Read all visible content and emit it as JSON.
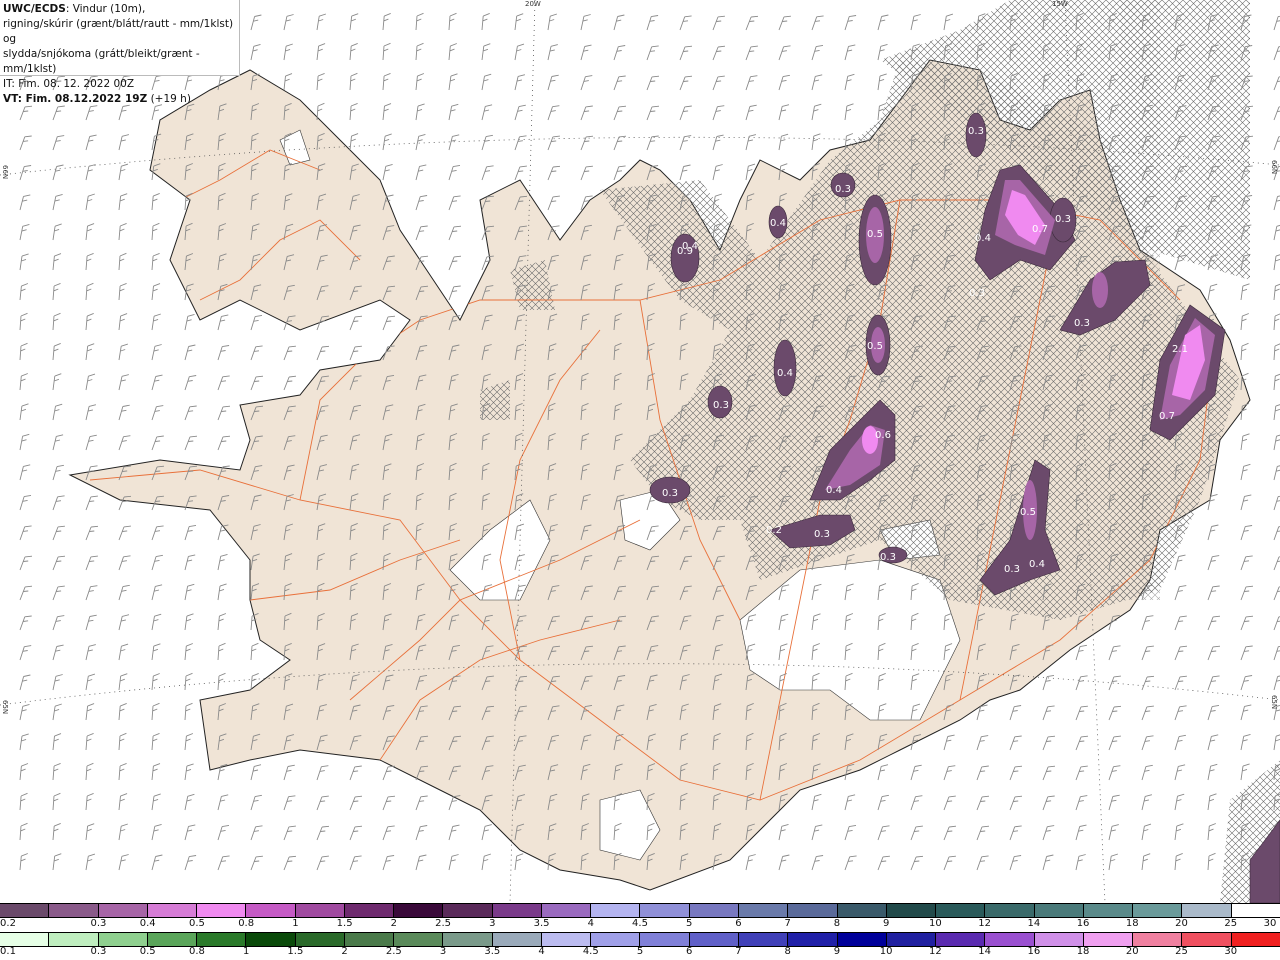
{
  "title": {
    "product": "UWC/ECDS",
    "line1_rest": ": Vindur (10m),",
    "line2": "rigning/skúrir (grænt/blátt/rautt - mm/1klst) og",
    "line3": "slydda/snjókoma (grátt/bleikt/grænt - mm/1klst)",
    "issue_time": "IT: Fim. 08. 12. 2022 00Z",
    "valid_label": "VT: Fim. 08.12.2022 19Z",
    "lead": " (+19 h)"
  },
  "grid_labels": {
    "lon_20w": "20W",
    "lon_15w": "15W",
    "lat_66n_left": "66N",
    "lat_66n_right": "66N",
    "lat_65n_left": "65N",
    "lat_65n_right": "65N"
  },
  "colors": {
    "land": "#f0e4d6",
    "coast": "#222222",
    "roads": "#e8703a",
    "wind_barb": "#888888",
    "glacier": "#ffffff",
    "hatch": "#666666"
  },
  "precip_labels": [
    {
      "text": "0.3"
    },
    {
      "text": "0.3"
    },
    {
      "text": "0.5"
    },
    {
      "text": "0.4"
    },
    {
      "text": "0.9"
    },
    {
      "text": "0.4"
    },
    {
      "text": "0.7"
    },
    {
      "text": "0.3"
    },
    {
      "text": "0.3"
    },
    {
      "text": "2.1"
    },
    {
      "text": "0.7"
    },
    {
      "text": "0.5"
    },
    {
      "text": "0.4"
    },
    {
      "text": "0.3"
    },
    {
      "text": "0.6"
    },
    {
      "text": "0.4"
    },
    {
      "text": "0.3"
    },
    {
      "text": "0.2"
    },
    {
      "text": "0.3"
    },
    {
      "text": "0.5"
    },
    {
      "text": "0.3"
    },
    {
      "text": "0.4"
    },
    {
      "text": "0.3"
    },
    {
      "text": "0.3"
    },
    {
      "text": "0.4"
    }
  ],
  "snow_scale": {
    "colors": [
      "#6b4a6b",
      "#8a5a8a",
      "#a765a7",
      "#d67cd6",
      "#f08af0",
      "#c55ac5",
      "#a04aa0",
      "#6e2a6e",
      "#3a0a3a",
      "#5a2a5a",
      "#7a3a8a",
      "#9a6abf",
      "#b4b4f0",
      "#9090d8",
      "#7878c0",
      "#6a7aaa",
      "#5a6a9a",
      "#3a5a6a",
      "#224a4a",
      "#2a5a5a",
      "#3a6a6a",
      "#4a7a7a",
      "#5a8a8a",
      "#6a9a9a",
      "#aabaca",
      "#ffffff"
    ],
    "ticks": [
      "0.2",
      "0.3",
      "0.4",
      "0.5",
      "0.8",
      "1",
      "1.5",
      "2",
      "2.5",
      "3",
      "3.5",
      "4",
      "4.5",
      "5",
      "6",
      "7",
      "8",
      "9",
      "10",
      "12",
      "14",
      "16",
      "18",
      "20",
      "25",
      "30"
    ]
  },
  "rain_scale": {
    "colors": [
      "#e6ffe6",
      "#bfeebf",
      "#8fd08f",
      "#5aa55a",
      "#2a7a2a",
      "#0a4a0a",
      "#2a6a2a",
      "#4a7a4a",
      "#5a8a5a",
      "#7a9a8a",
      "#9aaaba",
      "#bcbcf0",
      "#a0a0e8",
      "#8080d8",
      "#6060c8",
      "#4040b8",
      "#2020a8",
      "#00009a",
      "#2020a0",
      "#5a2ab0",
      "#9a50d0",
      "#d090e8",
      "#f0a0f0",
      "#f080a0",
      "#f05060",
      "#f02020"
    ],
    "ticks": [
      "0.1",
      "0.3",
      "0.5",
      "0.8",
      "1",
      "1.5",
      "2",
      "2.5",
      "3",
      "3.5",
      "4",
      "4.5",
      "5",
      "6",
      "7",
      "8",
      "9",
      "10",
      "12",
      "14",
      "16",
      "18",
      "20",
      "25",
      "30"
    ]
  }
}
